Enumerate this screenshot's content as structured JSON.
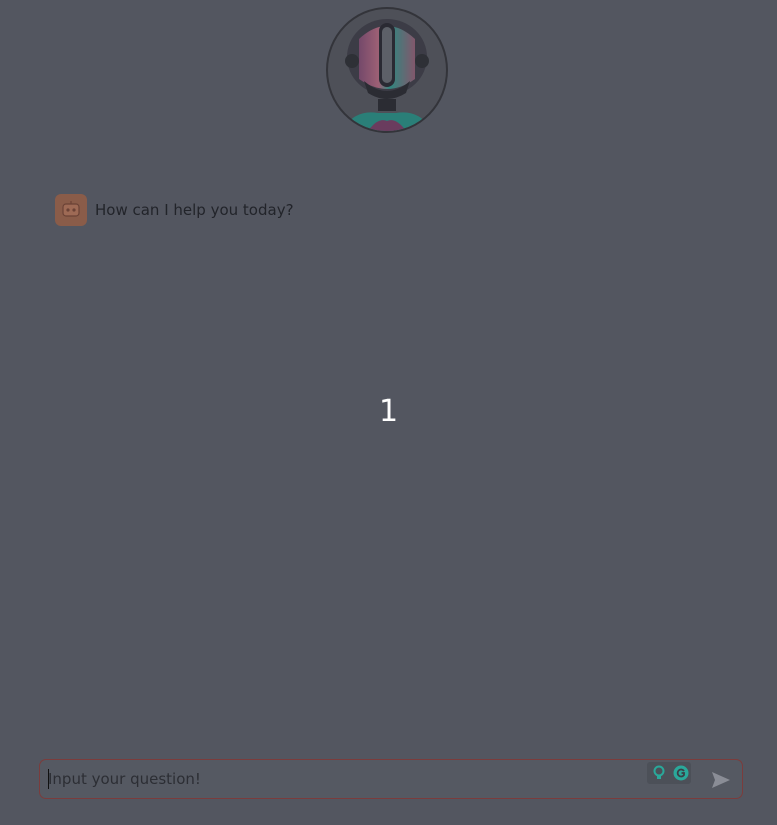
{
  "chat": {
    "messages": [
      {
        "role": "assistant",
        "text": "How can I help you today?"
      }
    ]
  },
  "overlay": {
    "step_number": "1"
  },
  "composer": {
    "placeholder": "Input your question!",
    "value": ""
  },
  "icons": {
    "logo": "robot-logo-icon",
    "avatar": "bot-avatar-icon",
    "tool_1": "lightbulb-icon",
    "tool_2": "grammarly-icon",
    "send": "send-icon"
  },
  "colors": {
    "background": "#535660",
    "input_border": "#7b3c3c",
    "avatar": "#8a5c49",
    "accent_teal": "#2aa89a"
  }
}
